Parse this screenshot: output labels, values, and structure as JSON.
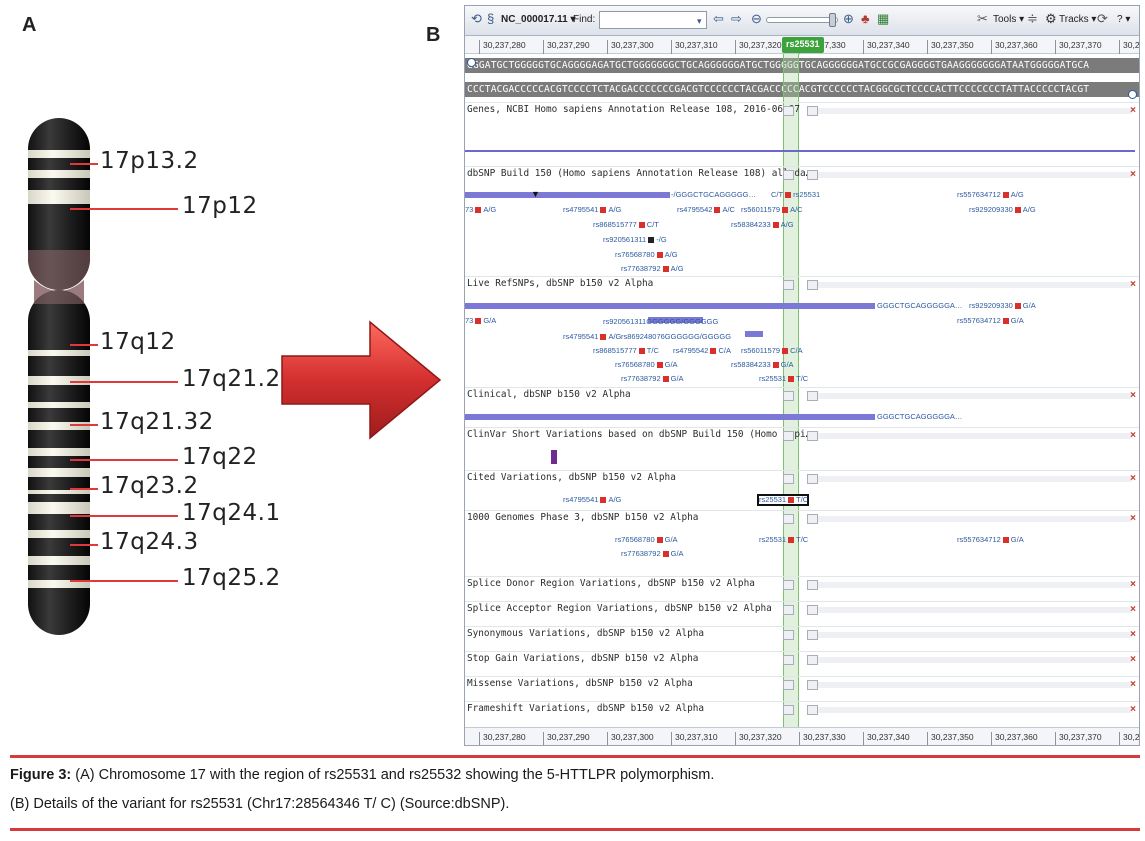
{
  "panel_a": {
    "letter": "A",
    "bands": [
      "17p13.2",
      "17p12",
      "17q12",
      "17q21.2",
      "17q21.32",
      "17q22",
      "17q23.2",
      "17q24.1",
      "17q24.3",
      "17q25.2"
    ]
  },
  "panel_b": {
    "letter": "B",
    "toolbar": {
      "sequence_select": "NC_000017.11",
      "find_label": "Find:",
      "find_value": "",
      "tools_label": "Tools",
      "tracks_label": "Tracks",
      "help_label": "?"
    },
    "ruler_ticks": [
      "30,237,280",
      "30,237,290",
      "30,237,300",
      "30,237,310",
      "30,237,320",
      "30,237,330",
      "30,237,340",
      "30,237,350",
      "30,237,360",
      "30,237,370",
      "30,2"
    ],
    "marker_label": "rs25531",
    "sequence_forward": "GGGATGCTGGGGGTGCAGGGGAGATGCTGGGGGGGCTGCAGGGGGGATGCTGGGGGTGCAGGGGGGATGCCGCGAGGGGTGAAGGGGGGGATAATGGGGGATGCA",
    "sequence_reverse": "CCCTACGACCCCCACGTCCCCTCTACGACCCCCCCGACGTCCCCCCTACGACCCCCACGTCCCCCCTACGGCGCTCCCCACTTCCCCCCCTATTACCCCCTACGT",
    "tracks": [
      "Genes, NCBI Homo sapiens Annotation Release 108, 2016-06-07",
      "dbSNP Build 150 (Homo sapiens Annotation Release 108) all da…",
      "Live RefSNPs, dbSNP b150 v2 Alpha",
      "Clinical, dbSNP b150 v2 Alpha",
      "ClinVar Short Variations based on dbSNP Build 150 (Homo sapi…",
      "Cited Variations, dbSNP b150 v2 Alpha",
      "1000 Genomes Phase 3, dbSNP b150 v2 Alpha",
      "Splice Donor Region Variations, dbSNP b150 v2 Alpha",
      "Splice Acceptor Region Variations, dbSNP b150 v2 Alpha",
      "Synonymous Variations, dbSNP b150 v2 Alpha",
      "Stop Gain Variations, dbSNP b150 v2 Alpha",
      "Missense Variations, dbSNP b150 v2 Alpha",
      "Frameshift Variations, dbSNP b150 v2 Alpha"
    ],
    "snps_dbsnp": [
      {
        "id": "-/GGGCTGCAGGGGG…",
        "allele": ""
      },
      {
        "id": "C/T",
        "allele": "rs25531"
      },
      {
        "id": "rs557634712",
        "allele": "A/G"
      },
      {
        "id": "73",
        "allele": "A/G"
      },
      {
        "id": "rs4795541",
        "allele": "A/G"
      },
      {
        "id": "rs4795542",
        "allele": "A/C"
      },
      {
        "id": "rs56011579",
        "allele": "A/C"
      },
      {
        "id": "rs929209330",
        "allele": "A/G"
      },
      {
        "id": "rs868515777",
        "allele": "C/T"
      },
      {
        "id": "rs58384233",
        "allele": "A/G"
      },
      {
        "id": "rs920561311",
        "allele": "-/G"
      },
      {
        "id": "rs76568780",
        "allele": "A/G"
      },
      {
        "id": "rs77638792",
        "allele": "A/G"
      }
    ],
    "snps_live": [
      {
        "id": "GGGCTGCAGGGGGA…",
        "allele": ""
      },
      {
        "id": "rs929209330",
        "allele": "G/A"
      },
      {
        "id": "73",
        "allele": "G/A"
      },
      {
        "id": "rs557634712",
        "allele": "G/A"
      },
      {
        "id": "rs920561311",
        "allele": "GGGGGG/GGGGGG"
      },
      {
        "id": "rs4795541",
        "allele": "A/G"
      },
      {
        "id": "rs869248076",
        "allele": "GGGGGG/GGGGG"
      },
      {
        "id": "rs868515777",
        "allele": "T/C"
      },
      {
        "id": "rs4795542",
        "allele": "C/A"
      },
      {
        "id": "rs56011579",
        "allele": "C/A"
      },
      {
        "id": "rs76568780",
        "allele": "G/A"
      },
      {
        "id": "rs58384233",
        "allele": "G/A"
      },
      {
        "id": "rs77638792",
        "allele": "G/A"
      },
      {
        "id": "rs25531",
        "allele": "T/C"
      }
    ],
    "snp_clinical": {
      "id": "GGGCTGCAGGGGGA…"
    },
    "snps_cited": [
      {
        "id": "rs4795541",
        "allele": "A/G"
      },
      {
        "id": "rs25531",
        "allele": "T/C"
      }
    ],
    "snps_1000g": [
      {
        "id": "rs76568780",
        "allele": "G/A"
      },
      {
        "id": "rs25531",
        "allele": "T/C"
      },
      {
        "id": "rs557634712",
        "allele": "G/A"
      },
      {
        "id": "rs77638792",
        "allele": "G/A"
      }
    ]
  },
  "caption": {
    "label": "Figure 3:",
    "line1": "(A) Chromosome 17 with the region of rs25531 and rs25532 showing the 5-HTTLPR polymorphism.",
    "line2": "(B) Details of the variant for rs25531 (Chr17:28564346 T/ C) (Source:dbSNP)."
  },
  "colors": {
    "band_line": "#e0393c",
    "arrow": "#d32f2f",
    "snp_marker": "#d9302c",
    "feature": "#7c79d6",
    "highlight": "#3ca33c",
    "caption_rule": "#d63a3a"
  }
}
